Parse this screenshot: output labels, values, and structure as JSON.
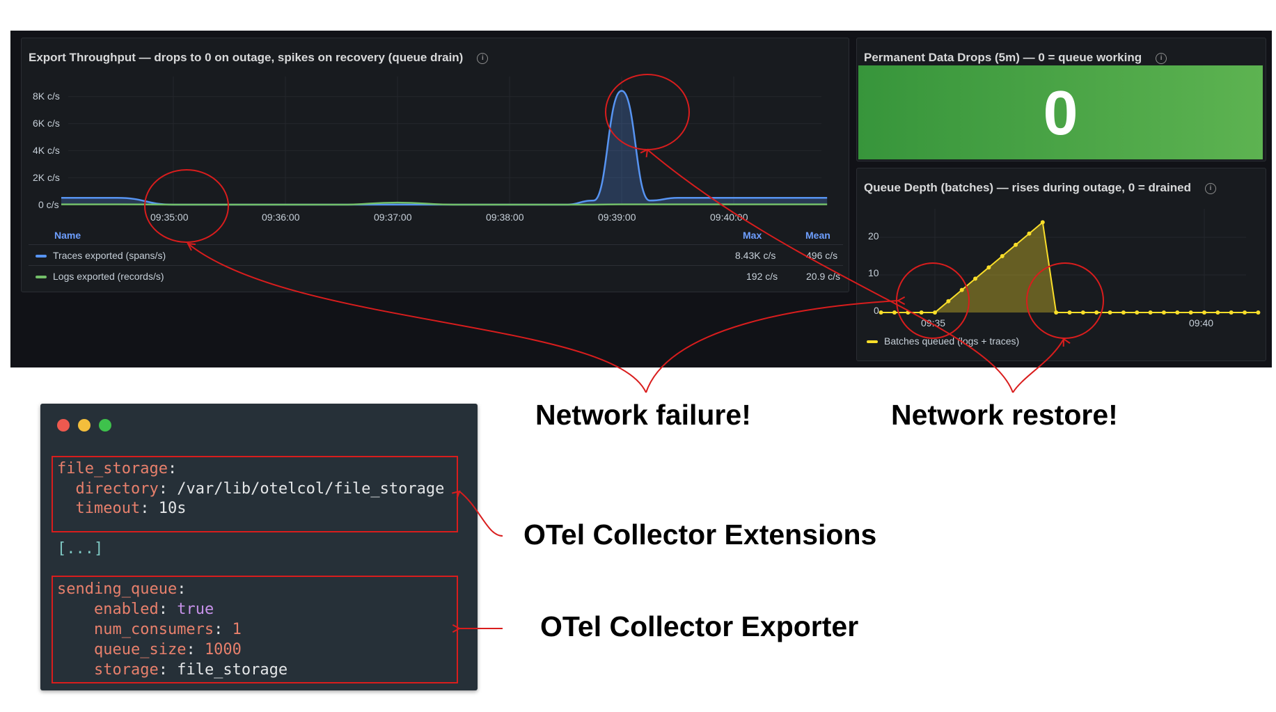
{
  "throughput_panel": {
    "title": "Export Throughput — drops to 0 on outage, spikes on recovery (queue drain)",
    "y_ticks": [
      "8K c/s",
      "6K c/s",
      "4K c/s",
      "2K c/s",
      "0 c/s"
    ],
    "x_ticks": [
      "09:35:00",
      "09:36:00",
      "09:37:00",
      "09:38:00",
      "09:39:00",
      "09:40:00"
    ],
    "legend_headers": {
      "name": "Name",
      "max": "Max",
      "mean": "Mean"
    },
    "legend_rows": [
      {
        "name": "Traces exported (spans/s)",
        "max": "8.43K c/s",
        "mean": "496 c/s",
        "color": "#5794f2"
      },
      {
        "name": "Logs exported (records/s)",
        "max": "192 c/s",
        "mean": "20.9 c/s",
        "color": "#73bf69"
      }
    ]
  },
  "drops_panel": {
    "title": "Permanent Data Drops (5m) — 0 = queue working",
    "value": "0",
    "color": "#56a64b"
  },
  "queue_panel": {
    "title": "Queue Depth (batches) — rises during outage, 0 = drained",
    "y_ticks": [
      "20",
      "10",
      "0"
    ],
    "x_ticks": [
      "09:35",
      "09:40"
    ],
    "legend": "Batches queued (logs + traces)",
    "color": "#fade2a"
  },
  "annotations": {
    "failure": "Network failure!",
    "restore": "Network restore!",
    "extensions": "OTel Collector Extensions",
    "exporter": "OTel Collector Exporter"
  },
  "code": {
    "line1_key": "file_storage",
    "line2_key": "directory",
    "line2_val": "/var/lib/otelcol/file_storage",
    "line3_key": "timeout",
    "line3_val": "10s",
    "ellipsis": "[...]",
    "line5_key": "sending_queue",
    "line6_key": "enabled",
    "line6_val": "true",
    "line7_key": "num_consumers",
    "line7_val": "1",
    "line8_key": "queue_size",
    "line8_val": "1000",
    "line9_key": "storage",
    "line9_val": "file_storage"
  },
  "chart_data": [
    {
      "type": "line",
      "title": "Export Throughput — drops to 0 on outage, spikes on recovery (queue drain)",
      "x": [
        "09:34:00",
        "09:34:30",
        "09:35:00",
        "09:35:30",
        "09:36:00",
        "09:36:30",
        "09:37:00",
        "09:37:30",
        "09:38:00",
        "09:38:30",
        "09:38:45",
        "09:39:00",
        "09:39:15",
        "09:39:30",
        "09:40:00",
        "09:40:30",
        "09:40:50"
      ],
      "series": [
        {
          "name": "Traces exported (spans/s)",
          "values": [
            500,
            500,
            0,
            0,
            0,
            0,
            0,
            0,
            0,
            0,
            300,
            8430,
            300,
            500,
            500,
            500,
            500
          ]
        },
        {
          "name": "Logs exported (records/s)",
          "values": [
            20,
            20,
            0,
            0,
            0,
            0,
            150,
            0,
            0,
            0,
            0,
            20,
            20,
            20,
            20,
            20,
            20
          ]
        }
      ],
      "ylim": [
        0,
        9000
      ]
    },
    {
      "type": "area",
      "title": "Queue Depth (batches) — rises during outage, 0 = drained",
      "x": [
        "09:34:00",
        "09:34:15",
        "09:34:30",
        "09:34:45",
        "09:35:00",
        "09:35:15",
        "09:35:30",
        "09:35:45",
        "09:36:00",
        "09:36:15",
        "09:36:30",
        "09:36:45",
        "09:37:00",
        "09:37:15",
        "09:37:30",
        "09:37:45",
        "09:38:00",
        "09:38:15",
        "09:38:30",
        "09:38:45",
        "09:39:00",
        "09:39:15",
        "09:39:30",
        "09:39:45",
        "09:40:00",
        "09:40:15",
        "09:40:30",
        "09:40:45",
        "09:41:00"
      ],
      "series": [
        {
          "name": "Batches queued (logs + traces)",
          "values": [
            0,
            0,
            0,
            0,
            0,
            3,
            6,
            9,
            12,
            15,
            18,
            21,
            24,
            0,
            0,
            0,
            0,
            0,
            0,
            0,
            0,
            0,
            0,
            0,
            0,
            0,
            0,
            0,
            0
          ]
        }
      ],
      "ylim": [
        0,
        25
      ]
    }
  ]
}
